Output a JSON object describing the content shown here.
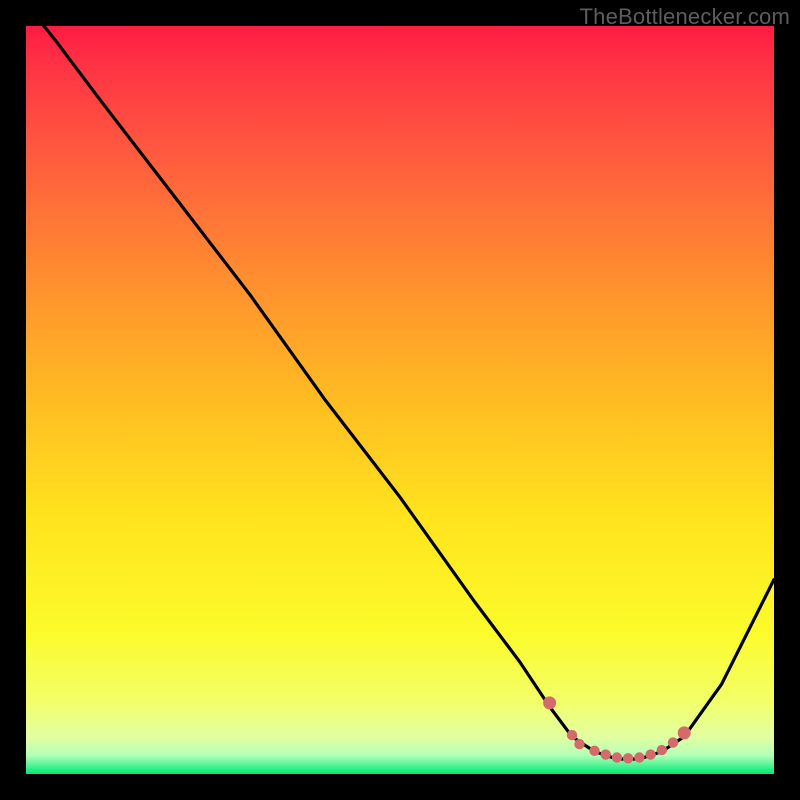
{
  "attribution": "TheBottlenecker.com",
  "colors": {
    "frame_bg": "#000000",
    "curve_stroke": "#000000",
    "marker_fill": "#d46a6a",
    "accent_green": "#00e874",
    "accent_red": "#ff1a42"
  },
  "chart_data": {
    "type": "line",
    "title": "",
    "xlabel": "",
    "ylabel": "",
    "xlim": [
      0,
      100
    ],
    "ylim": [
      0,
      100
    ],
    "x": [
      0,
      4,
      10,
      20,
      30,
      40,
      50,
      60,
      66,
      70,
      73,
      76,
      79,
      82,
      85,
      88,
      93,
      100
    ],
    "values": [
      103,
      98,
      90,
      77,
      64,
      50,
      37,
      23,
      15,
      9,
      5,
      3,
      2,
      2,
      3,
      5,
      12,
      26
    ],
    "markers_x": [
      70,
      73,
      74,
      76,
      77.5,
      79,
      80.5,
      82,
      83.5,
      85,
      86.5,
      88
    ],
    "markers_y": [
      9.5,
      5.2,
      4.0,
      3.1,
      2.6,
      2.2,
      2.1,
      2.2,
      2.6,
      3.2,
      4.2,
      5.5
    ],
    "grid": false,
    "legend": ""
  }
}
